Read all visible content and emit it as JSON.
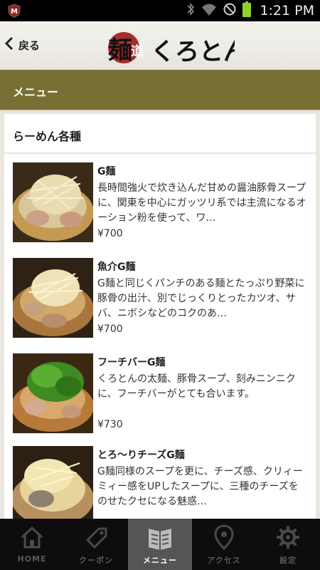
{
  "status_bar": {
    "time": "1:21 PM",
    "app_badge": "M"
  },
  "header": {
    "back_label": "戻る",
    "logo_text_1": "麺",
    "logo_text_2": "道",
    "logo_text_3": "くろとん"
  },
  "section": {
    "title": "メニュー"
  },
  "menu": {
    "category": "らーめん各種",
    "items": [
      {
        "name": "G麺",
        "desc": "長時間強火で炊き込んだ甘めの醤油豚骨スープに、関東を中心にガッツリ系では主流になるオーション粉を使って、ワ…",
        "price": "¥700"
      },
      {
        "name": "魚介G麺",
        "desc": "G麺と同じくパンチのある麺とたっぷり野菜に豚骨の出汁、別でじっくりとったカツオ、サバ、ニボシなどのコクのあ…",
        "price": "¥700"
      },
      {
        "name": "フーチバーG麺",
        "desc": "くろとんの太麺、豚骨スープ、刻みニンニクに、フーチバーがとても合います。",
        "price": "¥730"
      },
      {
        "name": "とろ～りチーズG麺",
        "desc": "G麺同様のスープを更に、チーズ感、クリィーミィー感をUPしたスープに、三種のチーズをのせたクセになる魅惑…",
        "price": ""
      }
    ]
  },
  "nav": [
    {
      "label": "HOME",
      "icon": "home-icon"
    },
    {
      "label": "クーポン",
      "icon": "coupon-icon"
    },
    {
      "label": "メニュー",
      "icon": "menu-book-icon"
    },
    {
      "label": "アクセス",
      "icon": "location-icon"
    },
    {
      "label": "設定",
      "icon": "gear-icon"
    }
  ],
  "colors": {
    "band": "#776f34",
    "nav_bg": "#0d0d0d",
    "nav_active": "#555555"
  }
}
